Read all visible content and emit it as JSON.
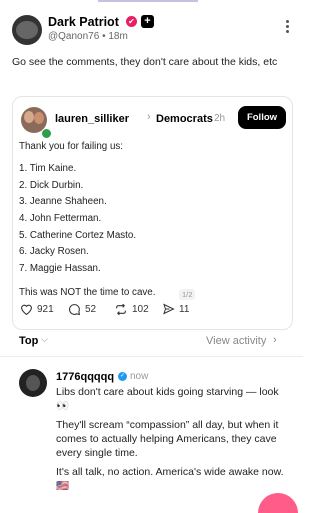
{
  "post": {
    "author": "Dark Patriot",
    "handle_time": "@Qanon76 • 18m",
    "text": "Go see the comments, they don't care about the kids, etc"
  },
  "quote": {
    "username": "lauren_silliker",
    "community": "Democrats",
    "time": "2h",
    "follow_label": "Follow",
    "intro": "Thank you for failing us:",
    "list": [
      "1. Tim Kaine.",
      "2. Dick Durbin.",
      "3. Jeanne Shaheen.",
      "4. John Fetterman.",
      "5. Catherine Cortez Masto.",
      "6. Jacky Rosen.",
      "7. Maggie Hassan."
    ],
    "closing": "This was NOT the time to cave.",
    "pager": "1/2"
  },
  "actions": {
    "likes": "921",
    "comments": "52",
    "reposts": "102",
    "shares": "11"
  },
  "filter": {
    "sort_label": "Top",
    "view_activity": "View activity"
  },
  "reply": {
    "username": "1776qqqqq",
    "time": "now",
    "p1": "Libs don't care about kids going starving — look 👀",
    "p2": "They'll scream “compassion” all day, but when it comes to actually helping Americans, they cave every single time.",
    "p3": "It's all talk, no action. America's wide awake now. 🇺🇸"
  },
  "icons": {
    "like": "heart-icon",
    "comment": "comment-icon",
    "repost": "repost-icon",
    "share": "share-icon"
  },
  "colors": {
    "badge": "#e91e63",
    "verified": "#1d9bf0",
    "online": "#2e9e4a",
    "fab": "#ff5c8a"
  }
}
